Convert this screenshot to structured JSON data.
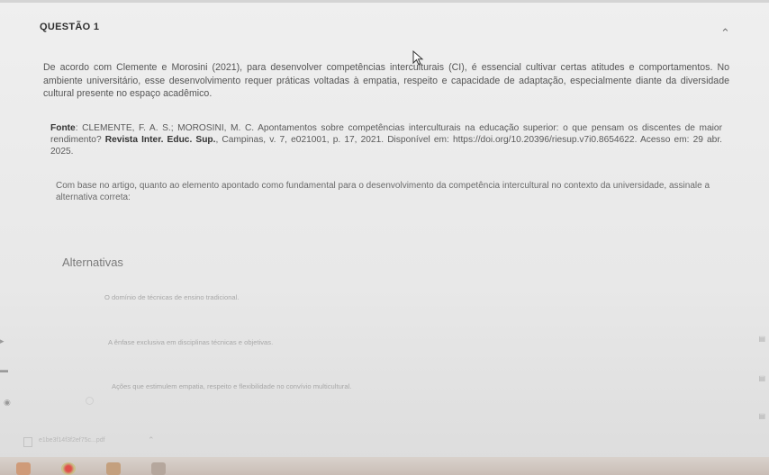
{
  "question": {
    "title": "QUESTÃO 1",
    "collapse_icon": "chevron-up-icon"
  },
  "statement": "De acordo com Clemente e Morosini (2021), para desenvolver competências interculturais (CI), é essencial cultivar certas atitudes e comportamentos. No ambiente universitário, esse desenvolvimento requer práticas voltadas à empatia, respeito e capacidade de adaptação, especialmente diante da diversidade cultural presente no espaço acadêmico.",
  "source": {
    "label": "Fonte",
    "text_before": ": CLEMENTE, F. A. S.; MOROSINI, M. C. Apontamentos sobre competências interculturais na educação superior: o que pensam os discentes de maior rendimento? ",
    "journal": "Revista Inter. Educ. Sup.",
    "text_after": ", Campinas, v. 7, e021001, p. 17, 2021. Disponível em: https://doi.org/10.20396/riesup.v7i0.8654622. Acesso em: 29 abr. 2025."
  },
  "prompt": "Com base no artigo, quanto ao elemento apontado como fundamental para o desenvolvimento da competência intercultural no contexto da universidade, assinale a alternativa correta:",
  "alternatives": {
    "title": "Alternativas",
    "items": [
      "O domínio de técnicas de ensino tradicional.",
      "A ênfase exclusiva em disciplinas técnicas e objetivas.",
      "Ações que estimulem empatia, respeito e flexibilidade no convívio multicultural."
    ]
  },
  "download_bar": {
    "filename": "e1be3f14f3f2ef75c...pdf",
    "file_icon": "pdf-file-icon",
    "caret_icon": "chevron-up-icon"
  },
  "colors": {
    "background": "#e9eaea",
    "text": "#555555",
    "alternative_text": "#a8a8a8"
  }
}
